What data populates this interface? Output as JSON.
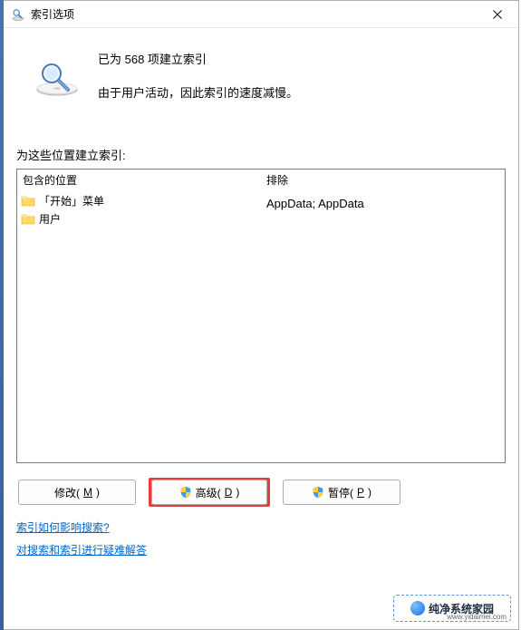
{
  "window": {
    "title": "索引选项",
    "close_label": "×"
  },
  "status": {
    "line1": "已为 568 项建立索引",
    "line2": "由于用户活动，因此索引的速度减慢。"
  },
  "locations": {
    "section_label": "为这些位置建立索引:",
    "headers": {
      "include": "包含的位置",
      "exclude": "排除"
    },
    "items": [
      {
        "name": "「开始」菜单",
        "exclude": ""
      },
      {
        "name": "用户",
        "exclude": "AppData; AppData"
      }
    ]
  },
  "buttons": {
    "modify": {
      "label": "修改(",
      "accel": "M",
      "suffix": ")"
    },
    "advanced": {
      "label": "高级(",
      "accel": "D",
      "suffix": ")"
    },
    "pause": {
      "label": "暂停(",
      "accel": "P",
      "suffix": ")"
    }
  },
  "links": {
    "how_affects": "索引如何影响搜索?",
    "troubleshoot": "对搜索和索引进行疑难解答"
  },
  "branding": {
    "name": "纯净系统家园",
    "url": "www.yidaimei.com"
  }
}
